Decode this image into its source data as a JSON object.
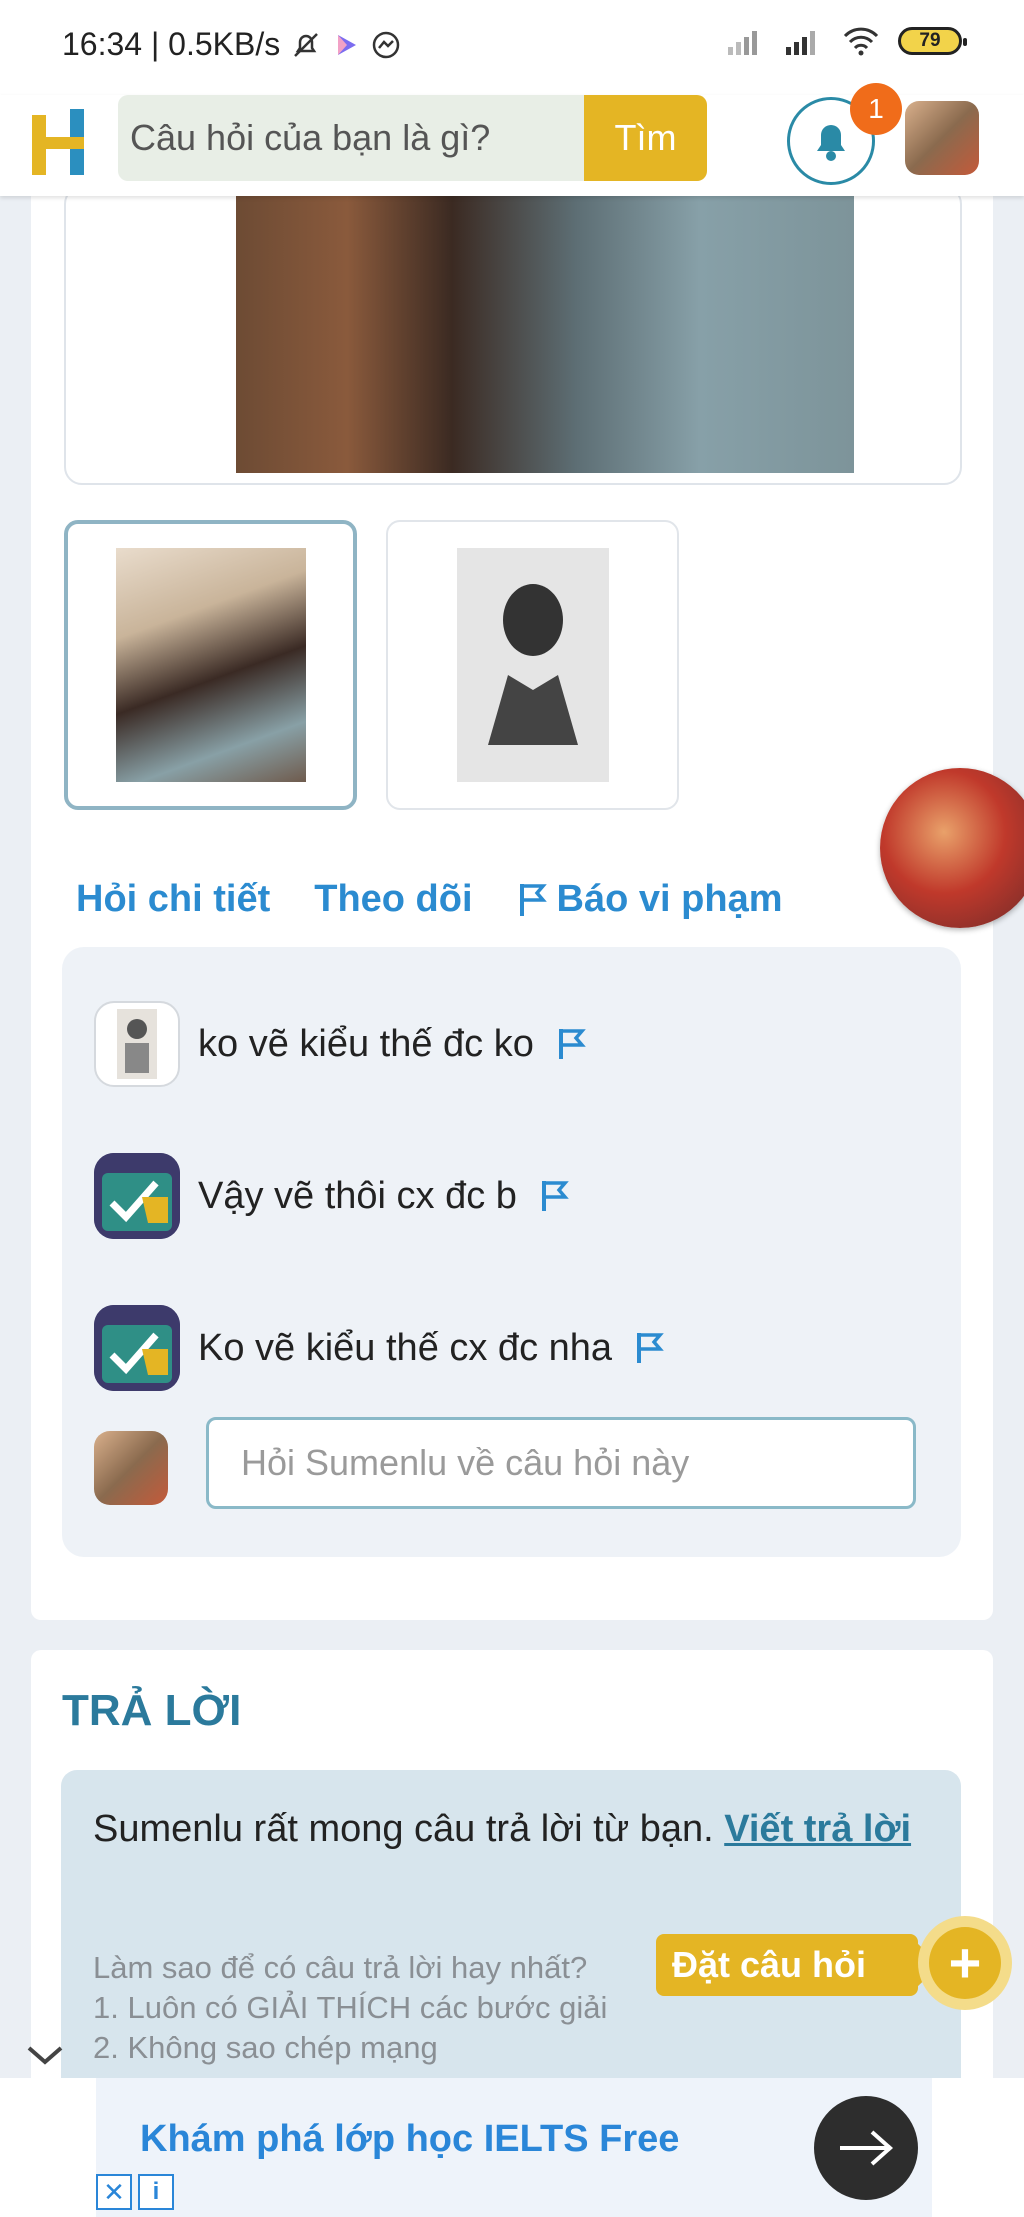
{
  "status_bar": {
    "time_speed": "16:34 | 0.5KB/s",
    "battery": "79"
  },
  "header": {
    "search_placeholder": "Câu hỏi của bạn là gì?",
    "search_button": "Tìm",
    "notification_count": "1"
  },
  "question": {
    "actions": {
      "ask_detail": "Hỏi chi tiết",
      "follow": "Theo dõi",
      "report": "Báo vi phạm"
    },
    "comments": [
      {
        "text": "ko vẽ kiểu thế đc ko"
      },
      {
        "text": "Vậy vẽ thôi cx đc b"
      },
      {
        "text": "Ko vẽ kiểu thế cx đc nha"
      }
    ],
    "ask_input_placeholder": "Hỏi Sumenlu về câu hỏi này"
  },
  "answer": {
    "title": "TRẢ LỜI",
    "lead_text": "Sumenlu rất mong câu trả lời từ bạn. ",
    "write_link": "Viết trả lời",
    "tips_title": "Làm sao để có câu trả lời hay nhất?",
    "tips": [
      "1. Luôn có GIẢI THÍCH các bước giải",
      "2. Không sao chép mạng"
    ]
  },
  "fab": {
    "ask_question": "Đặt câu hỏi",
    "plus": "+"
  },
  "ad": {
    "text": "Khám phá lớp học IELTS Free",
    "close": "✕",
    "info": "i"
  },
  "colors": {
    "brand_yellow": "#e4b524",
    "brand_teal": "#2b7a9c",
    "link_blue": "#2b8bd0",
    "badge_orange": "#f06c1a"
  }
}
